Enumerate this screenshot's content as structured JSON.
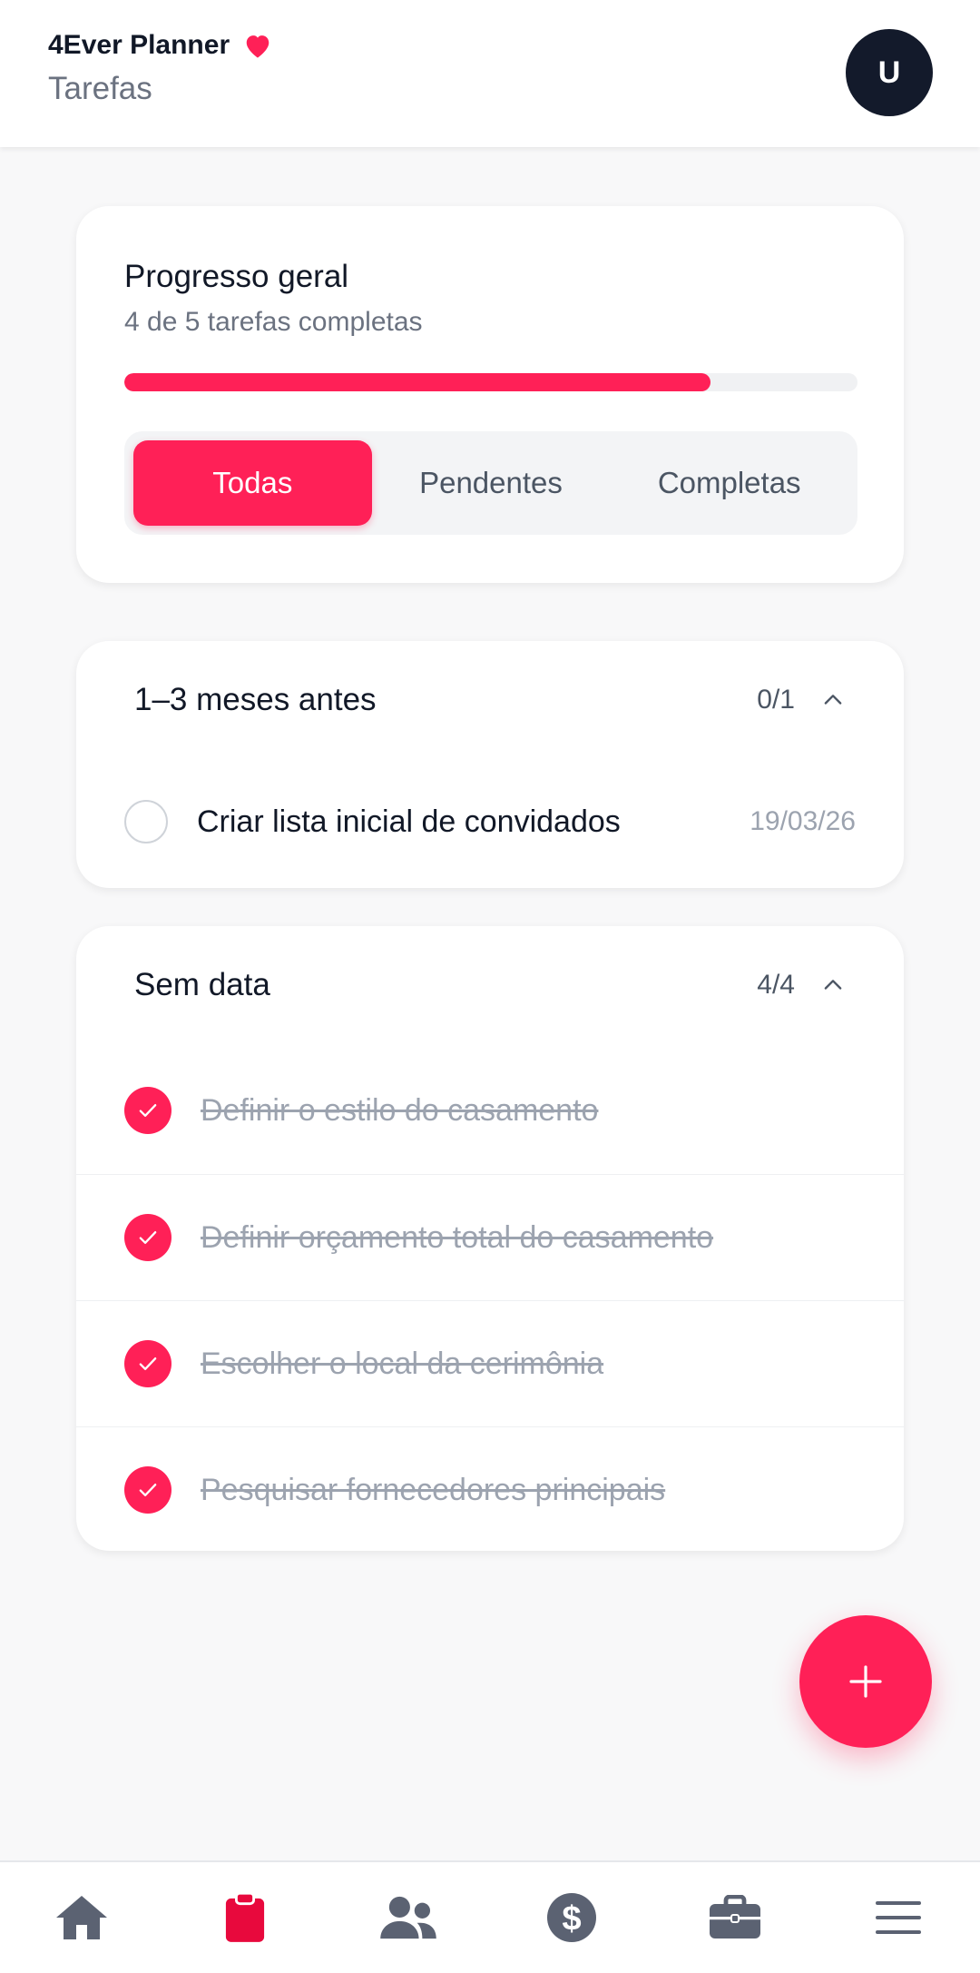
{
  "header": {
    "app_name": "4Ever Planner",
    "page_title": "Tarefas",
    "avatar_initial": "U",
    "heart_icon": "heart-icon"
  },
  "progress": {
    "title": "Progresso geral",
    "subtitle": "4 de 5 tarefas completas",
    "completed": 4,
    "total": 5,
    "fraction": 0.8
  },
  "filters": {
    "tabs": [
      "Todas",
      "Pendentes",
      "Completas"
    ],
    "selected": "Todas"
  },
  "sections": [
    {
      "title": "1–3 meses antes",
      "count": "0/1",
      "expanded": true,
      "tasks": [
        {
          "text": "Criar lista inicial de convidados",
          "date": "19/03/26",
          "done": false
        }
      ]
    },
    {
      "title": "Sem data",
      "count": "4/4",
      "expanded": true,
      "tasks": [
        {
          "text": "Definir o estilo do casamento",
          "date": "",
          "done": true
        },
        {
          "text": "Definir orçamento total do casamento",
          "date": "",
          "done": true
        },
        {
          "text": "Escolher o local da cerimônia",
          "date": "",
          "done": true
        },
        {
          "text": "Pesquisar fornecedores principais",
          "date": "",
          "done": true
        }
      ]
    }
  ],
  "fab": {
    "icon": "plus-icon"
  },
  "bottom_nav": [
    {
      "icon": "home-icon",
      "active": false
    },
    {
      "icon": "clipboard-icon",
      "active": true
    },
    {
      "icon": "users-icon",
      "active": false
    },
    {
      "icon": "dollar-icon",
      "active": false
    },
    {
      "icon": "briefcase-icon",
      "active": false
    },
    {
      "icon": "menu-icon",
      "active": false
    }
  ],
  "colors": {
    "accent": "#ff2057",
    "dark": "#131a2b",
    "muted": "#6b7280",
    "nav_icon": "#5b6272"
  }
}
